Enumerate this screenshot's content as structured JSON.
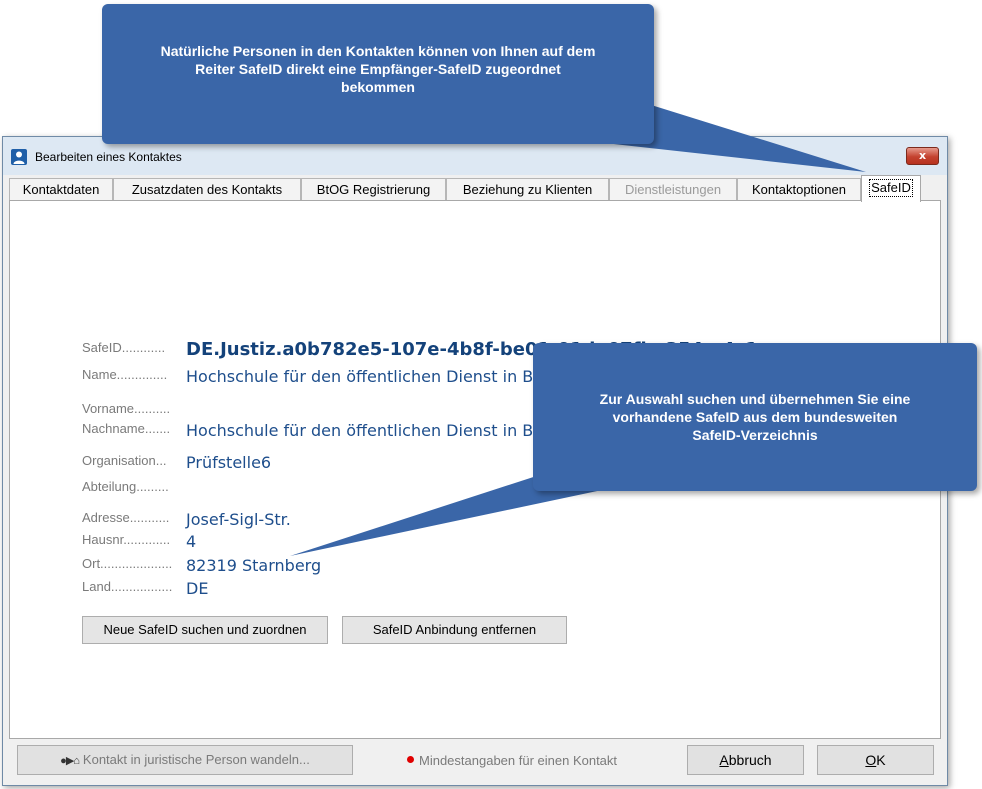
{
  "window": {
    "title": "Bearbeiten eines Kontaktes",
    "close_symbol": "x"
  },
  "tabs": [
    {
      "label": "Kontaktdaten",
      "state": "normal"
    },
    {
      "label": "Zusatzdaten des Kontakts",
      "state": "normal"
    },
    {
      "label": "BtOG Registrierung",
      "state": "normal"
    },
    {
      "label": "Beziehung zu Klienten",
      "state": "normal"
    },
    {
      "label": "Dienstleistungen",
      "state": "disabled"
    },
    {
      "label": "Kontaktoptionen",
      "state": "normal"
    },
    {
      "label": "SafeID",
      "state": "active"
    }
  ],
  "fields": {
    "safeid": {
      "label": "SafeID............",
      "value": "DE.Justiz.a0b782e5-107e-4b8f-be01-01de07fbe354.a4c1"
    },
    "name": {
      "label": "Name..............",
      "value": "Hochschule für den öffentlichen Dienst in Bayern, Fachbereich Rechtspflege"
    },
    "vorname": {
      "label": "Vorname..........",
      "value": ""
    },
    "nachname": {
      "label": "Nachname.......",
      "value": "Hochschule für den öffentlichen Dienst in Bayern"
    },
    "organisation": {
      "label": "Organisation...",
      "value": "Prüfstelle6"
    },
    "abteilung": {
      "label": "Abteilung.........",
      "value": ""
    },
    "adresse": {
      "label": "Adresse...........",
      "value": "Josef-Sigl-Str."
    },
    "hausnr": {
      "label": "Hausnr.............",
      "value": "4"
    },
    "ort": {
      "label": "Ort....................",
      "value": "82319  Starnberg"
    },
    "land": {
      "label": "Land.................",
      "value": "DE"
    }
  },
  "buttons": {
    "search_assign": "Neue SafeID suchen und zuordnen",
    "remove": "SafeID Anbindung entfernen"
  },
  "footer": {
    "convert_icon": "person-to-house",
    "convert_label": "Kontakt in juristische Person wandeln...",
    "required_note": "Mindestangaben für einen Kontakt",
    "cancel_underline": "A",
    "cancel_rest": "bbruch",
    "ok_underline": "O",
    "ok_rest": "K"
  },
  "callouts": {
    "top": "Natürliche Personen in den Kontakten können von Ihnen auf dem Reiter SafeID direkt eine Empfänger-SafeID zugeordnet bekommen",
    "right": "Zur Auswahl suchen und übernehmen Sie eine vorhandene SafeID aus dem bundesweiten SafeID-Verzeichnis"
  },
  "colors": {
    "callout": "#3a66a8",
    "value_text": "#1e4e8c",
    "required_dot": "#e00000"
  }
}
